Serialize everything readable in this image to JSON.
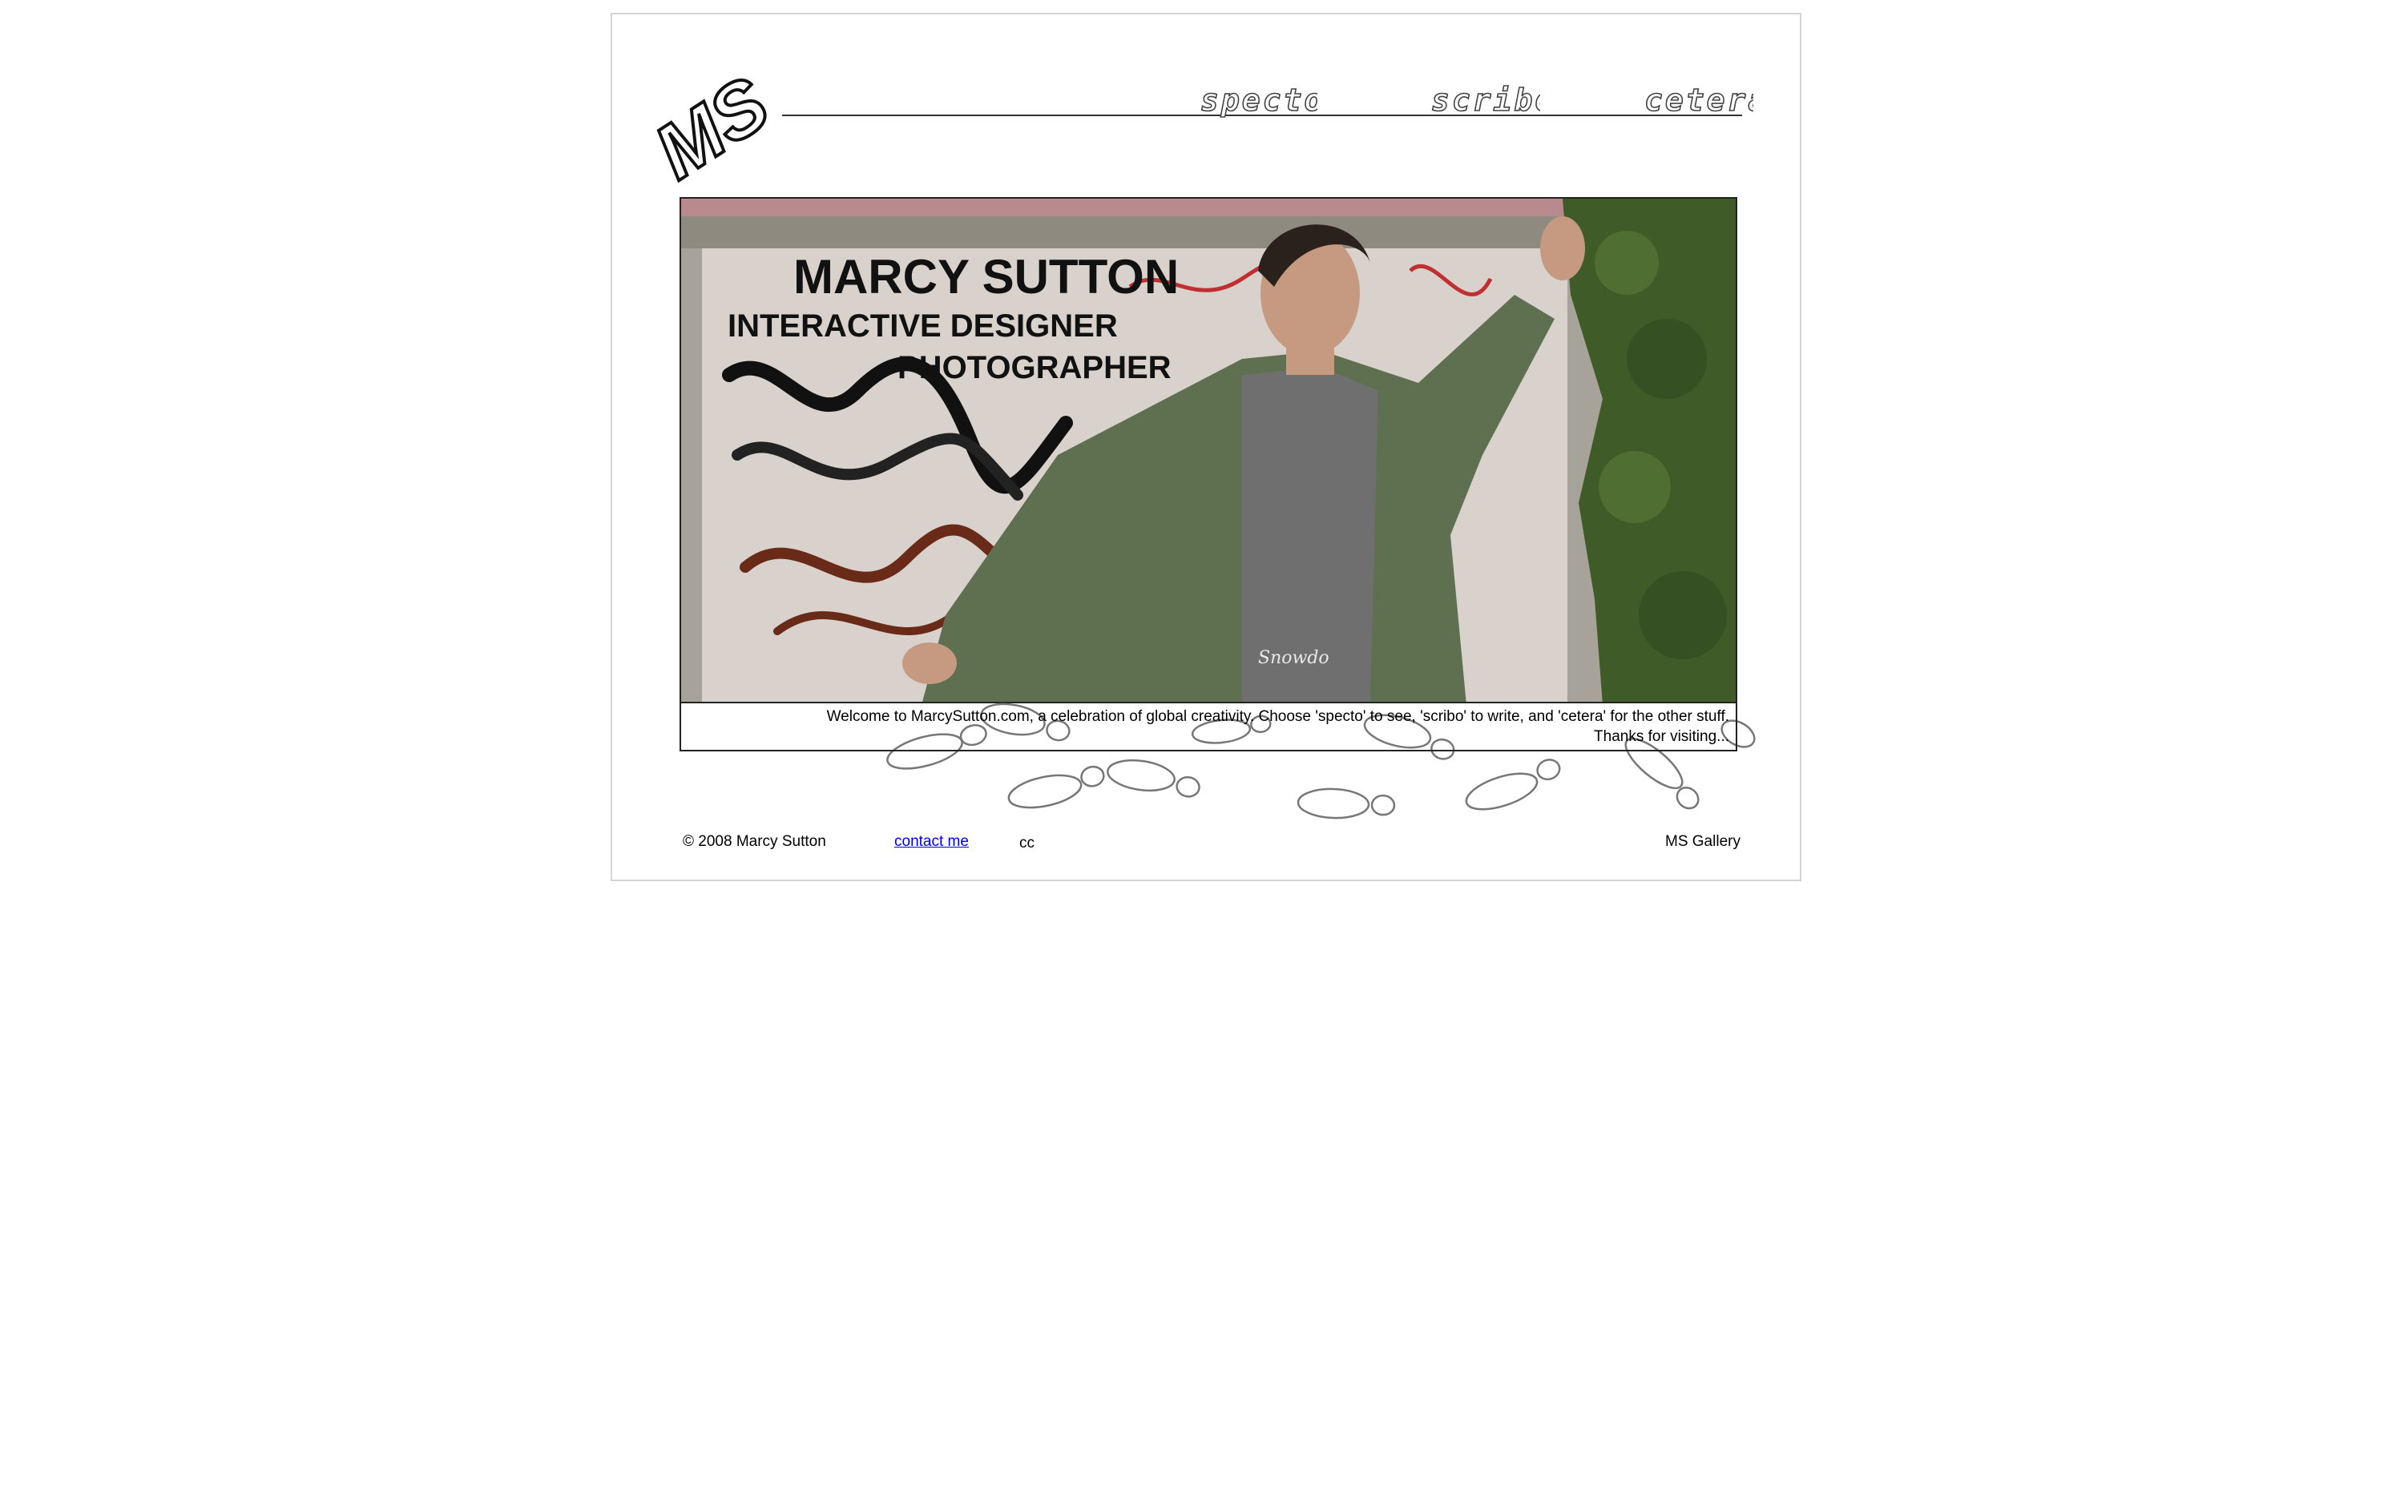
{
  "logo": {
    "text": "MS"
  },
  "nav": [
    {
      "id": "specto",
      "label": "specto"
    },
    {
      "id": "scribo",
      "label": "scribo"
    },
    {
      "id": "cetera",
      "label": "cetera"
    }
  ],
  "hero": {
    "name": "MARCY SUTTON",
    "line1": "INTERACTIVE DESIGNER",
    "line2": "PHOTOGRAPHER",
    "shirt_text": "Snowdo"
  },
  "caption": {
    "line1": "Welcome to MarcySutton.com, a celebration of global creativity. Choose 'specto' to see, 'scribo' to write, and 'cetera' for the other stuff.",
    "line2": "Thanks for visiting..."
  },
  "footer": {
    "copyright": "© 2008 Marcy Sutton",
    "contact": "contact me",
    "cc": "cc",
    "gallery": "MS Gallery"
  },
  "colors": {
    "frame_border": "#d4d4d4",
    "rule": "#333333",
    "jacket": "#5f7050",
    "wall": "#d9d2cc",
    "ivy": "#3f5b28",
    "brick": "#7a4a38"
  }
}
